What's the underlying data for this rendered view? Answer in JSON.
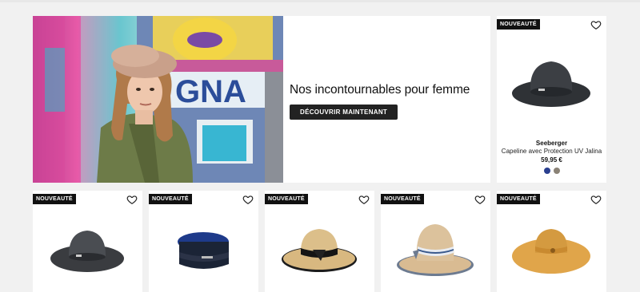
{
  "hero": {
    "title": "Nos incontournables pour femme",
    "cta_label": "DÉCOUVRIR MAINTENANT"
  },
  "featured_product": {
    "badge": "NOUVEAUTÉ",
    "brand": "Seeberger",
    "name": "Capeline avec Protection UV Jalina",
    "price": "59,95 €",
    "swatches": [
      "#2a3f8f",
      "#8a8276"
    ]
  },
  "products": [
    {
      "badge": "NOUVEAUTÉ"
    },
    {
      "badge": "NOUVEAUTÉ"
    },
    {
      "badge": "NOUVEAUTÉ"
    },
    {
      "badge": "NOUVEAUTÉ"
    },
    {
      "badge": "NOUVEAUTÉ"
    }
  ]
}
